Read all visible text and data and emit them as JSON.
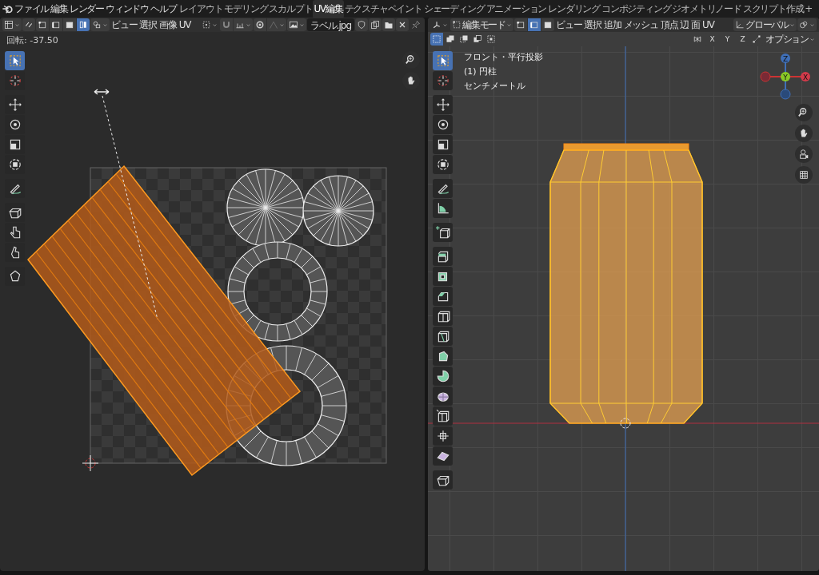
{
  "menu": [
    "ファイル",
    "編集",
    "レンダー",
    "ウィンドウ",
    "ヘルプ"
  ],
  "workspaces": [
    {
      "label": "レイアウト",
      "selected": false
    },
    {
      "label": "モデリング",
      "selected": false
    },
    {
      "label": "スカルプト",
      "selected": false
    },
    {
      "label": "UV編集",
      "selected": true
    },
    {
      "label": "テクスチャペイント",
      "selected": false
    },
    {
      "label": "シェーディング",
      "selected": false
    },
    {
      "label": "アニメーション",
      "selected": false
    },
    {
      "label": "レンダリング",
      "selected": false
    },
    {
      "label": "コンポジティング",
      "selected": false
    },
    {
      "label": "ジオメトリノード",
      "selected": false
    },
    {
      "label": "スクリプト作成",
      "selected": false
    }
  ],
  "add_workspace": "+",
  "uv_editor": {
    "select_modes": [
      {
        "kind": "vertex",
        "selected": false
      },
      {
        "kind": "edge",
        "selected": false
      },
      {
        "kind": "face",
        "selected": false
      },
      {
        "kind": "island",
        "selected": true
      }
    ],
    "menus": [
      "ビュー",
      "選択",
      "画像",
      "UV"
    ],
    "image_name": "ラベル.jpg",
    "status": "回転: -37.50",
    "tools": [
      {
        "kind": "select",
        "selected": true
      },
      {
        "kind": "cursor",
        "selected": false
      },
      {
        "kind": "move",
        "selected": false
      },
      {
        "kind": "rotate",
        "selected": false
      },
      {
        "kind": "scale",
        "selected": false
      },
      {
        "kind": "transform",
        "selected": false
      },
      {
        "kind": "annotate",
        "selected": false
      },
      {
        "kind": "rip",
        "selected": false
      },
      {
        "kind": "grab",
        "selected": false
      },
      {
        "kind": "relax",
        "selected": false
      },
      {
        "kind": "pinch",
        "selected": false
      }
    ]
  },
  "viewport": {
    "mode": "編集モード",
    "select_modes": [
      {
        "kind": "vertex",
        "selected": false
      },
      {
        "kind": "edge",
        "selected": true
      },
      {
        "kind": "face",
        "selected": false
      }
    ],
    "menus": [
      "ビュー",
      "選択",
      "追加",
      "メッシュ",
      "頂点",
      "辺",
      "面",
      "UV"
    ],
    "orientation": "グローバル",
    "box_modes": [
      {
        "kind": "set",
        "selected": true
      },
      {
        "kind": "extend",
        "selected": false
      },
      {
        "kind": "subtract",
        "selected": false
      },
      {
        "kind": "invert",
        "selected": false
      },
      {
        "kind": "intersect",
        "selected": false
      }
    ],
    "mirror_axes": [
      "X",
      "Y",
      "Z"
    ],
    "options": "オプション",
    "overlay": [
      "フロント・平行投影",
      "(1) 円柱",
      "センチメートル"
    ],
    "gizmo": {
      "z": "Z",
      "y": "Y",
      "x": "X"
    },
    "tools": [
      {
        "kind": "select",
        "selected": true
      },
      {
        "kind": "cursor",
        "selected": false
      },
      {
        "kind": "move",
        "selected": false
      },
      {
        "kind": "rotate",
        "selected": false
      },
      {
        "kind": "scale",
        "selected": false
      },
      {
        "kind": "transform",
        "selected": false
      },
      {
        "kind": "annotate",
        "selected": false
      },
      {
        "kind": "measure",
        "selected": false
      },
      {
        "kind": "add-cube",
        "selected": false
      },
      {
        "kind": "extrude",
        "selected": false
      },
      {
        "kind": "inset",
        "selected": false
      },
      {
        "kind": "bevel",
        "selected": false
      },
      {
        "kind": "loop-cut",
        "selected": false
      },
      {
        "kind": "knife",
        "selected": false
      },
      {
        "kind": "poly-build",
        "selected": false
      },
      {
        "kind": "spin",
        "selected": false
      },
      {
        "kind": "smooth",
        "selected": false
      },
      {
        "kind": "edge-slide",
        "selected": false
      },
      {
        "kind": "shrink",
        "selected": false
      },
      {
        "kind": "shear",
        "selected": false
      },
      {
        "kind": "rip",
        "selected": false
      }
    ]
  }
}
